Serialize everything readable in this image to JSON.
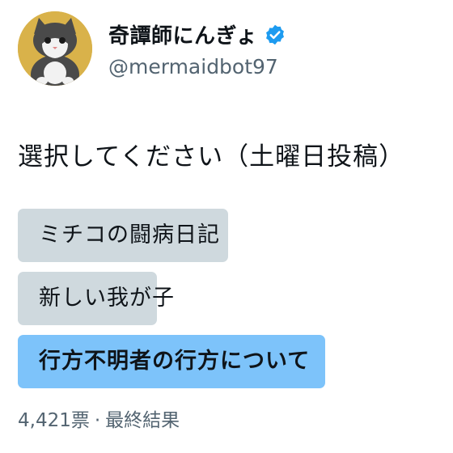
{
  "profile": {
    "name": "奇譚師にんぎょ",
    "handle": "@mermaidbot97",
    "avatar_icon": "cat-avatar",
    "verified_icon": "verified-badge-icon",
    "verified_color": "#1d9bf0"
  },
  "question": "選択してください（土曜日投稿）",
  "poll": {
    "options": [
      {
        "label": "ミチコの闘病日記",
        "share": 0.5,
        "winner": false
      },
      {
        "label": "新しい我が子",
        "share": 0.33,
        "winner": false
      },
      {
        "label": "行方不明者の行方について",
        "share": 0.73,
        "winner": true
      }
    ],
    "votes": "4,421票",
    "separator": "·",
    "status": "最終結果"
  },
  "colors": {
    "bar": "#cfd9de",
    "winner_bar": "#7dc3fa",
    "secondary_text": "#536471"
  }
}
